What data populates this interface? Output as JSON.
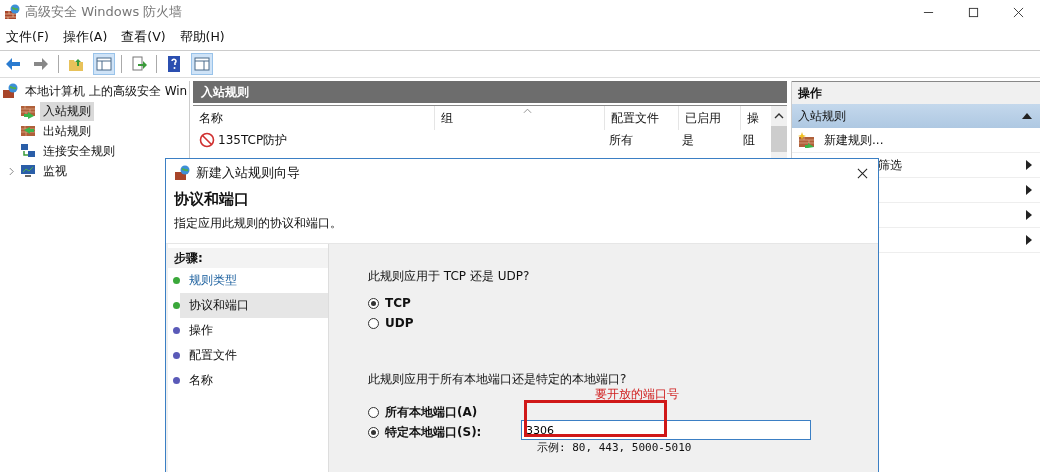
{
  "window": {
    "title": "高级安全 Windows 防火墙"
  },
  "menu": [
    "文件(F)",
    "操作(A)",
    "查看(V)",
    "帮助(H)"
  ],
  "tree": {
    "label": "本地计算机 上的高级安全 Win",
    "children": [
      {
        "label": "入站规则",
        "selected": true
      },
      {
        "label": "出站规则",
        "selected": false
      },
      {
        "label": "连接安全规则",
        "selected": false
      },
      {
        "label": "监视",
        "selected": false,
        "expanded": false
      }
    ]
  },
  "rules_panel": {
    "title": "入站规则",
    "columns": [
      "名称",
      "组",
      "配置文件",
      "已启用",
      "操"
    ],
    "rows": [
      {
        "name": "135TCP防护",
        "profile": "所有",
        "enabled": "是",
        "column_5": "阻"
      }
    ]
  },
  "actions_panel": {
    "title": "操作",
    "section": {
      "label": "入站规则",
      "expanded": true
    },
    "items": [
      {
        "kind": "action",
        "label": "新建规则..."
      },
      {
        "kind": "submenu",
        "label": "筛选"
      },
      {
        "kind": "submenu"
      },
      {
        "kind": "submenu"
      },
      {
        "kind": "submenu"
      }
    ]
  },
  "dialog": {
    "title": "新建入站规则向导",
    "heading": "协议和端口",
    "subtitle": "指定应用此规则的协议和端口。",
    "steps_title": "步骤:",
    "steps": [
      {
        "label": "规则类型",
        "selected": false,
        "link": true,
        "color": "#3aa83a"
      },
      {
        "label": "协议和端口",
        "selected": true,
        "link": false,
        "color": "#3aa83a"
      },
      {
        "label": "操作",
        "selected": false,
        "link": false,
        "color": "#5a5ab8"
      },
      {
        "label": "配置文件",
        "selected": false,
        "link": false,
        "color": "#5a5ab8"
      },
      {
        "label": "名称",
        "selected": false,
        "link": false,
        "color": "#5a5ab8"
      }
    ],
    "protocol_question": "此规则应用于 TCP 还是 UDP?",
    "protocols": [
      {
        "label": "TCP",
        "selected": true
      },
      {
        "label": "UDP",
        "selected": false
      }
    ],
    "port_question": "此规则应用于所有本地端口还是特定的本地端口?",
    "port_options": [
      {
        "label": "所有本地端口(A)",
        "selected": false
      },
      {
        "label": "特定本地端口(S):",
        "selected": true
      }
    ],
    "port_field": {
      "value": "3306"
    },
    "example": "示例: 80, 443, 5000-5010",
    "annotation": "要开放的端口号"
  }
}
